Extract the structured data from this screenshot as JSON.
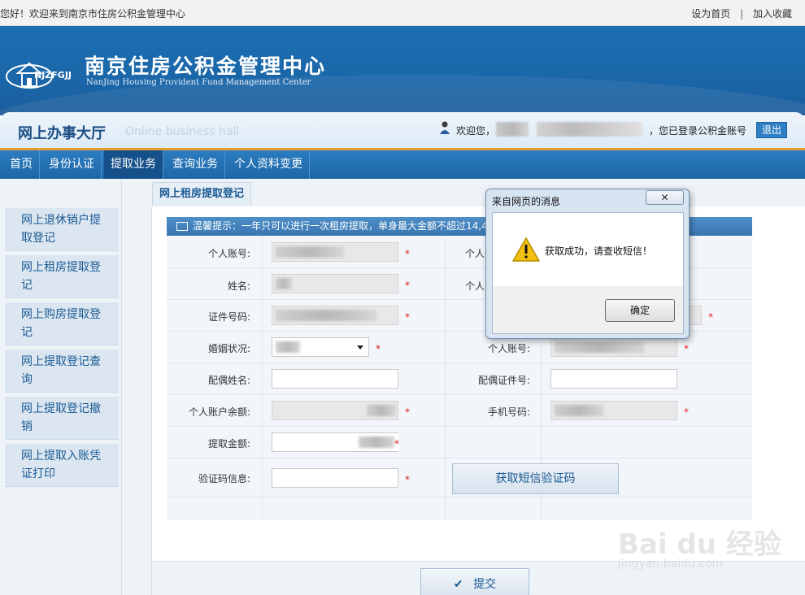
{
  "topbar": {
    "welcome": "您好！欢迎来到南京市住房公积金管理中心",
    "set_home": "设为首页",
    "separator": "|",
    "add_fav": "加入收藏"
  },
  "header": {
    "logo_abbr": "NJZFGJJ",
    "title_cn": "南京住房公积金管理中心",
    "title_en": "NanJing Housing Provident Fund Management Center"
  },
  "hall": {
    "title_cn": "网上办事大厅",
    "title_en": "Online business hall",
    "greeting": "欢迎您，",
    "logged_in": "，您已登录公积金账号",
    "logout": "退出"
  },
  "nav": {
    "items": [
      "首页",
      "身份认证",
      "提取业务",
      "查询业务",
      "个人资料变更"
    ],
    "active_index": 2
  },
  "sidebar": {
    "items": [
      {
        "line1": "网上退休销户提",
        "line2": "取登记"
      },
      {
        "line1": "网上租房提取登",
        "line2": "记"
      },
      {
        "line1": "网上购房提取登",
        "line2": "记"
      },
      {
        "line1": "网上提取登记查",
        "line2": "询"
      },
      {
        "line1": "网上提取登记撤",
        "line2": "销"
      },
      {
        "line1": "网上提取入账凭",
        "line2": "证打印"
      }
    ]
  },
  "tab": {
    "label": "网上租房提取登记"
  },
  "notice": {
    "text": "温馨提示：一年只可以进行一次租房提取，单身最大金额不超过14,4"
  },
  "form": {
    "account_no_label": "个人账号:",
    "name_label": "姓名:",
    "id_no_label": "证件号码:",
    "marital_label": "婚姻状况:",
    "spouse_name_label": "配偶姓名:",
    "balance_label": "个人账户余额:",
    "amount_label": "提取金额:",
    "captcha_label": "验证码信息:",
    "r1_label": "个人",
    "r2_label": "个人",
    "r4_label": "个人账号:",
    "spouse_id_label": "配偶证件号:",
    "phone_label": "手机号码:",
    "required_mark": "*",
    "sms_button": "获取短信验证码",
    "submit": "提交"
  },
  "dialog": {
    "title": "来自网页的消息",
    "close": "✕",
    "message": "获取成功，请查收短信！",
    "ok": "确定"
  },
  "watermark": {
    "brand": "Bai du 经验",
    "url": "jingyan.baidu.com"
  },
  "colors": {
    "brand_blue": "#1d6fb3",
    "nav_active": "#15508a",
    "accent_orange": "#e49b2f",
    "required": "#e02020"
  }
}
